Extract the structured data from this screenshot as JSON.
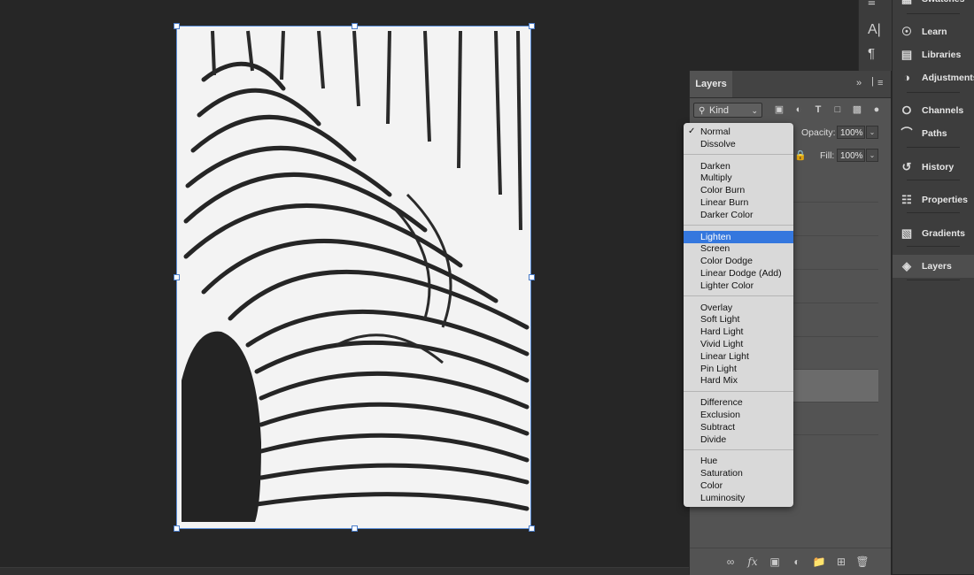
{
  "layers_panel": {
    "title": "Layers",
    "kind_filter": "Kind",
    "opacity_label": "Opacity:",
    "opacity_value": "100%",
    "fill_label": "Fill:",
    "fill_value": "100%"
  },
  "blend_menu": {
    "selected": "Normal",
    "highlighted": "Lighten",
    "groups": [
      [
        "Normal",
        "Dissolve"
      ],
      [
        "Darken",
        "Multiply",
        "Color Burn",
        "Linear Burn",
        "Darker Color"
      ],
      [
        "Lighten",
        "Screen",
        "Color Dodge",
        "Linear Dodge (Add)",
        "Lighter Color"
      ],
      [
        "Overlay",
        "Soft Light",
        "Hard Light",
        "Vivid Light",
        "Linear Light",
        "Pin Light",
        "Hard Mix"
      ],
      [
        "Difference",
        "Exclusion",
        "Subtract",
        "Divide"
      ],
      [
        "Hue",
        "Saturation",
        "Color",
        "Luminosity"
      ]
    ]
  },
  "right_dock": {
    "swatches_label": "Swatches",
    "items": [
      {
        "label": "Learn",
        "icon": "lightbulb-icon"
      },
      {
        "label": "Libraries",
        "icon": "libraries-icon"
      },
      {
        "label": "Adjustments",
        "icon": "adjustments-icon"
      },
      {
        "label": "Channels",
        "icon": "channels-icon"
      },
      {
        "label": "Paths",
        "icon": "paths-icon"
      },
      {
        "label": "History",
        "icon": "history-icon"
      },
      {
        "label": "Properties",
        "icon": "properties-icon"
      },
      {
        "label": "Gradients",
        "icon": "gradients-icon"
      },
      {
        "label": "Layers",
        "icon": "layers-icon"
      }
    ],
    "active": "Layers"
  },
  "colors": {
    "highlight": "#3477de",
    "canvas_bg": "#262626",
    "panel_bg": "#535353",
    "selection_border": "#5b8ed8"
  }
}
